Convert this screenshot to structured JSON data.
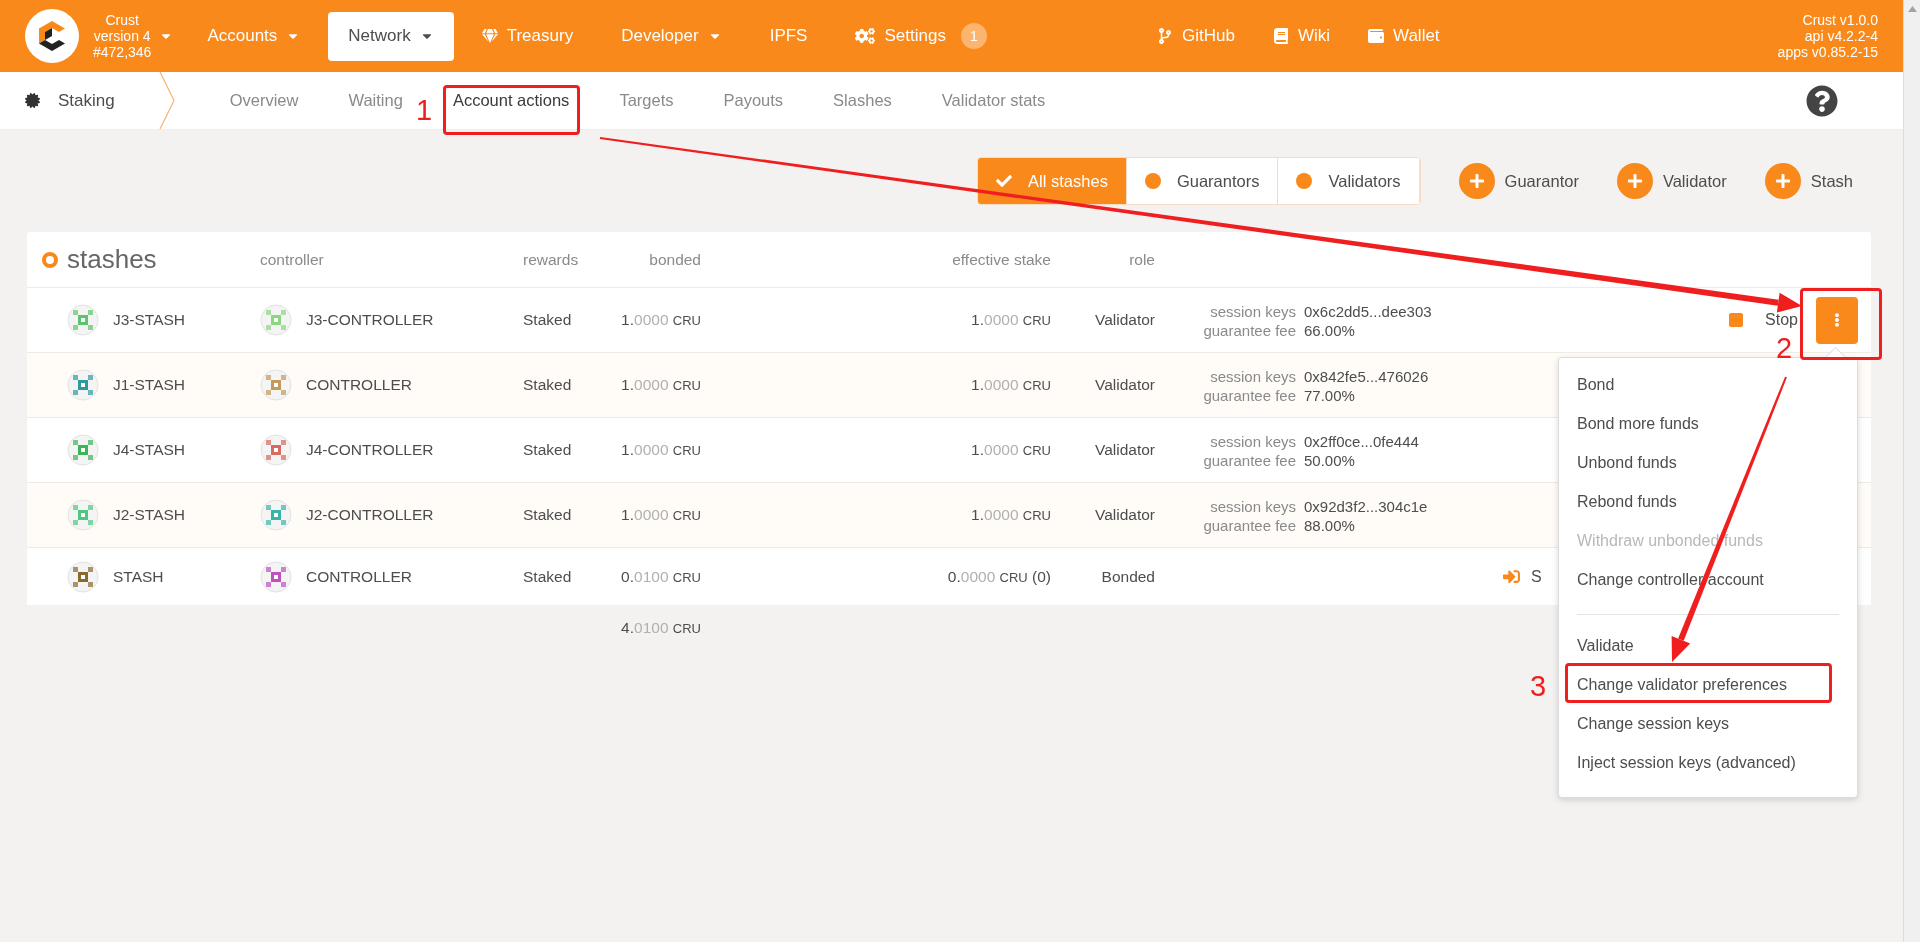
{
  "header": {
    "chain": {
      "name": "Crust",
      "version": "version 4",
      "block": "#472,346"
    },
    "nav": [
      {
        "label": "Accounts",
        "kind": "dropdown",
        "selected": false
      },
      {
        "label": "Network",
        "kind": "dropdown",
        "selected": true
      },
      {
        "label": "Treasury",
        "kind": "treasury",
        "selected": false
      },
      {
        "label": "Developer",
        "kind": "dropdown",
        "selected": false
      },
      {
        "label": "IPFS",
        "kind": "plain",
        "selected": false
      },
      {
        "label": "Settings",
        "kind": "settings",
        "selected": false,
        "badge": "1"
      }
    ],
    "links": [
      {
        "label": "GitHub",
        "kind": "github"
      },
      {
        "label": "Wiki",
        "kind": "wiki"
      },
      {
        "label": "Wallet",
        "kind": "wallet"
      }
    ],
    "versions": [
      "Crust v1.0.0",
      "api v4.2.2-4",
      "apps v0.85.2-15"
    ]
  },
  "subnav": {
    "section": "Staking",
    "tabs": [
      {
        "label": "Overview",
        "selected": false
      },
      {
        "label": "Waiting",
        "selected": false
      },
      {
        "label": "Account actions",
        "selected": true
      },
      {
        "label": "Targets",
        "selected": false
      },
      {
        "label": "Payouts",
        "selected": false
      },
      {
        "label": "Slashes",
        "selected": false
      },
      {
        "label": "Validator stats",
        "selected": false
      }
    ]
  },
  "filters": [
    {
      "label": "All stashes",
      "selected": true
    },
    {
      "label": "Guarantors",
      "selected": false
    },
    {
      "label": "Validators",
      "selected": false
    }
  ],
  "add_buttons": [
    "Guarantor",
    "Validator",
    "Stash"
  ],
  "table": {
    "title": "stashes",
    "columns": [
      "controller",
      "rewards",
      "bonded",
      "effective stake",
      "role"
    ],
    "rows": [
      {
        "stash": "J3-STASH",
        "controller": "J3-CONTROLLER",
        "rewards": "Staked",
        "bonded": {
          "int": "1.",
          "frac": "0000",
          "unit": "CRU"
        },
        "effective": {
          "int": "1.",
          "frac": "0000",
          "unit": "CRU"
        },
        "role": "Validator",
        "keys_label": "session keys",
        "keys": "0x6c2dd5...dee303",
        "fee_label": "guarantee fee",
        "fee": "66.00%",
        "action": {
          "kind": "stop",
          "label": "Stop",
          "menu_open": true
        }
      },
      {
        "stash": "J1-STASH",
        "controller": "CONTROLLER",
        "rewards": "Staked",
        "bonded": {
          "int": "1.",
          "frac": "0000",
          "unit": "CRU"
        },
        "effective": {
          "int": "1.",
          "frac": "0000",
          "unit": "CRU"
        },
        "role": "Validator",
        "keys_label": "session keys",
        "keys": "0x842fe5...476026",
        "fee_label": "guarantee fee",
        "fee": "77.00%"
      },
      {
        "stash": "J4-STASH",
        "controller": "J4-CONTROLLER",
        "rewards": "Staked",
        "bonded": {
          "int": "1.",
          "frac": "0000",
          "unit": "CRU"
        },
        "effective": {
          "int": "1.",
          "frac": "0000",
          "unit": "CRU"
        },
        "role": "Validator",
        "keys_label": "session keys",
        "keys": "0x2ff0ce...0fe444",
        "fee_label": "guarantee fee",
        "fee": "50.00%"
      },
      {
        "stash": "J2-STASH",
        "controller": "J2-CONTROLLER",
        "rewards": "Staked",
        "bonded": {
          "int": "1.",
          "frac": "0000",
          "unit": "CRU"
        },
        "effective": {
          "int": "1.",
          "frac": "0000",
          "unit": "CRU"
        },
        "role": "Validator",
        "keys_label": "session keys",
        "keys": "0x92d3f2...304c1e",
        "fee_label": "guarantee fee",
        "fee": "88.00%"
      },
      {
        "stash": "STASH",
        "controller": "CONTROLLER",
        "rewards": "Staked",
        "bonded": {
          "int": "0.",
          "frac": "0100",
          "unit": "CRU"
        },
        "effective": {
          "int": "0.",
          "frac": "0000",
          "unit": "CRU",
          "extra": "(0)"
        },
        "role": "Bonded",
        "action": {
          "kind": "start",
          "label": "S",
          "menu_open": false
        }
      }
    ],
    "total": {
      "int": "4.",
      "frac": "0100",
      "unit": "CRU"
    }
  },
  "menu": {
    "sections": [
      {
        "items": [
          {
            "label": "Bond",
            "disabled": false
          },
          {
            "label": "Bond more funds",
            "disabled": false
          },
          {
            "label": "Unbond funds",
            "disabled": false
          },
          {
            "label": "Rebond funds",
            "disabled": false
          },
          {
            "label": "Withdraw unbonded funds",
            "disabled": true
          },
          {
            "label": "Change controller account",
            "disabled": false
          }
        ]
      },
      {
        "items": [
          {
            "label": "Validate",
            "disabled": false
          },
          {
            "label": "Change validator preferences",
            "disabled": false
          },
          {
            "label": "Change session keys",
            "disabled": false
          },
          {
            "label": "Inject session keys (advanced)",
            "disabled": false
          }
        ]
      }
    ]
  },
  "annotations": [
    {
      "number": "1"
    },
    {
      "number": "2"
    },
    {
      "number": "3"
    }
  ]
}
